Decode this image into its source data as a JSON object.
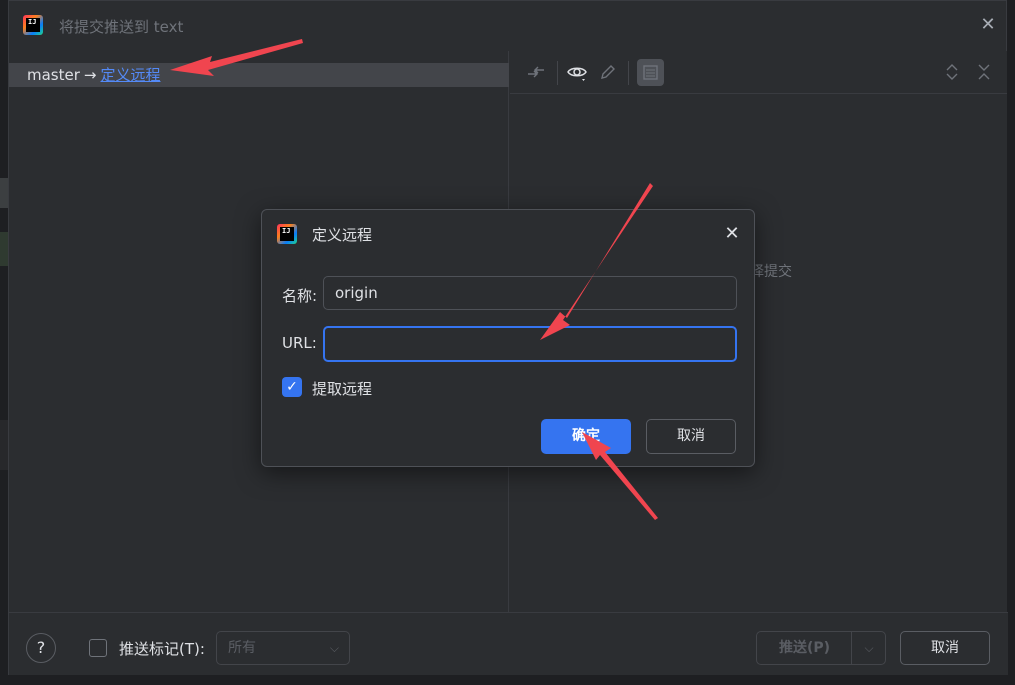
{
  "window": {
    "title": "将提交推送到 text",
    "logo_text": "IJ"
  },
  "left_pane": {
    "branch": "master",
    "arrow": "→",
    "remote_link": "定义远程"
  },
  "right_pane": {
    "hint": "择提交"
  },
  "bottom": {
    "help": "?",
    "push_tags_label": "推送标记(T):",
    "tags_combo_value": "所有",
    "push_button": "推送(P)",
    "cancel_button": "取消"
  },
  "dialog": {
    "title": "定义远程",
    "logo_text": "IJ",
    "name_label": "名称:",
    "name_value": "origin",
    "url_label": "URL:",
    "url_value": "",
    "fetch_label": "提取远程",
    "fetch_checked": true,
    "ok_button": "确定",
    "cancel_button": "取消"
  },
  "colors": {
    "accent": "#3574f0",
    "link": "#548af7",
    "annotation": "#f0454f"
  }
}
